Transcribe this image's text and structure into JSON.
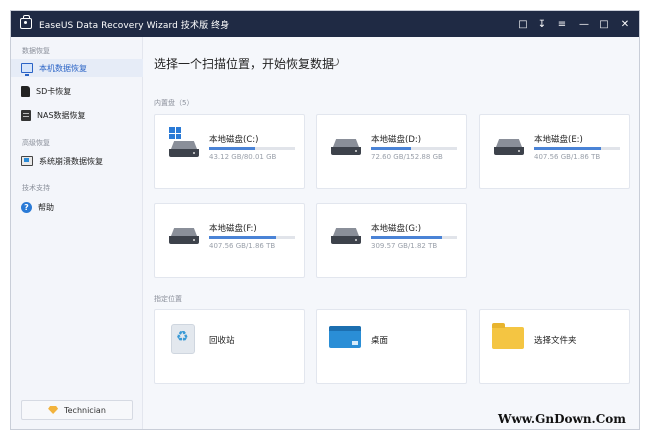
{
  "window": {
    "title": "EaseUS Data Recovery Wizard 技术版 终身",
    "controls": [
      "feedback-icon",
      "export-icon",
      "menu-icon",
      "minimize-icon",
      "maximize-icon",
      "close-icon"
    ]
  },
  "sidebar": {
    "section_recovery": "数据恢复",
    "items": [
      {
        "label": "本机数据恢复",
        "icon": "monitor-icon",
        "active": true
      },
      {
        "label": "SD卡恢复",
        "icon": "sd-card-icon"
      },
      {
        "label": "NAS数据恢复",
        "icon": "nas-icon"
      }
    ],
    "section_advanced": "高级恢复",
    "advanced_items": [
      {
        "label": "系统崩溃数据恢复",
        "icon": "crash-recovery-icon"
      }
    ],
    "section_support": "技术支持",
    "support_items": [
      {
        "label": "帮助",
        "icon": "help-icon"
      }
    ],
    "technician_label": "Technician"
  },
  "main": {
    "title": "选择一个扫描位置，开始恢复数据",
    "internal_label": "内置盘（5）",
    "drives": [
      {
        "name": "本地磁盘(C:)",
        "size": "43.12 GB/80.01 GB",
        "used_fraction": 0.54,
        "system": true
      },
      {
        "name": "本地磁盘(D:)",
        "size": "72.60 GB/152.88 GB",
        "used_fraction": 0.47
      },
      {
        "name": "本地磁盘(E:)",
        "size": "407.56 GB/1.86 TB",
        "used_fraction": 0.78
      },
      {
        "name": "本地磁盘(F:)",
        "size": "407.56 GB/1.86 TB",
        "used_fraction": 0.78
      },
      {
        "name": "本地磁盘(G:)",
        "size": "309.57 GB/1.82 TB",
        "used_fraction": 0.83
      }
    ],
    "locations_label": "指定位置",
    "locations": [
      {
        "name": "回收站",
        "icon": "recycle-bin-icon"
      },
      {
        "name": "桌面",
        "icon": "desktop-icon"
      },
      {
        "name": "选择文件夹",
        "icon": "folder-icon"
      }
    ]
  },
  "watermark": "Www.GnDown.Com",
  "colors": {
    "titlebar": "#1f2a44",
    "accent": "#2a63c6",
    "bar_fill": "#4a83d6"
  }
}
